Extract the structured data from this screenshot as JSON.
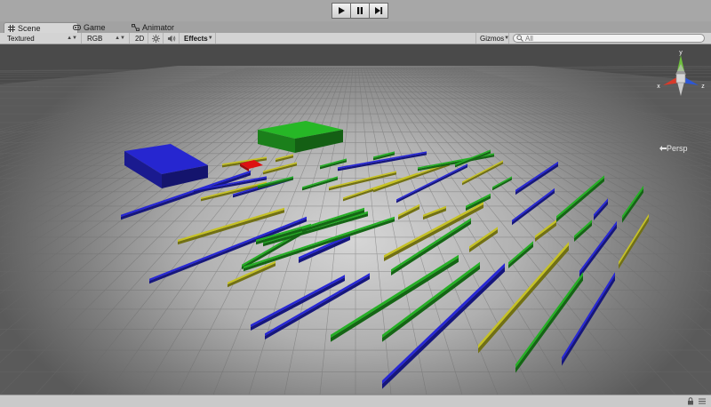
{
  "playbar": {
    "buttons": [
      {
        "name": "play",
        "icon": "play-icon"
      },
      {
        "name": "pause",
        "icon": "pause-icon"
      },
      {
        "name": "step",
        "icon": "step-icon"
      }
    ]
  },
  "tabs": [
    {
      "label": "Scene",
      "icon": "scene-grid-icon",
      "active": true
    },
    {
      "label": "Game",
      "icon": "game-icon",
      "active": false
    },
    {
      "label": "Animator",
      "icon": "animator-icon",
      "active": false
    }
  ],
  "toolbar": {
    "draw_mode": "Textured",
    "render_mode": "RGB",
    "mode_2d": "2D",
    "lighting_icon": "sun-icon",
    "audio_icon": "speaker-icon",
    "effects": "Effects",
    "gizmos": "Gizmos",
    "search_placeholder": "All"
  },
  "viewport": {
    "projection": "Persp",
    "gizmo_axes": {
      "x": "x",
      "y": "y",
      "z": "z"
    },
    "colors": {
      "green": "#22a322",
      "blue": "#2424c6",
      "yellow": "#b7b422",
      "red": "#dd1111"
    }
  }
}
